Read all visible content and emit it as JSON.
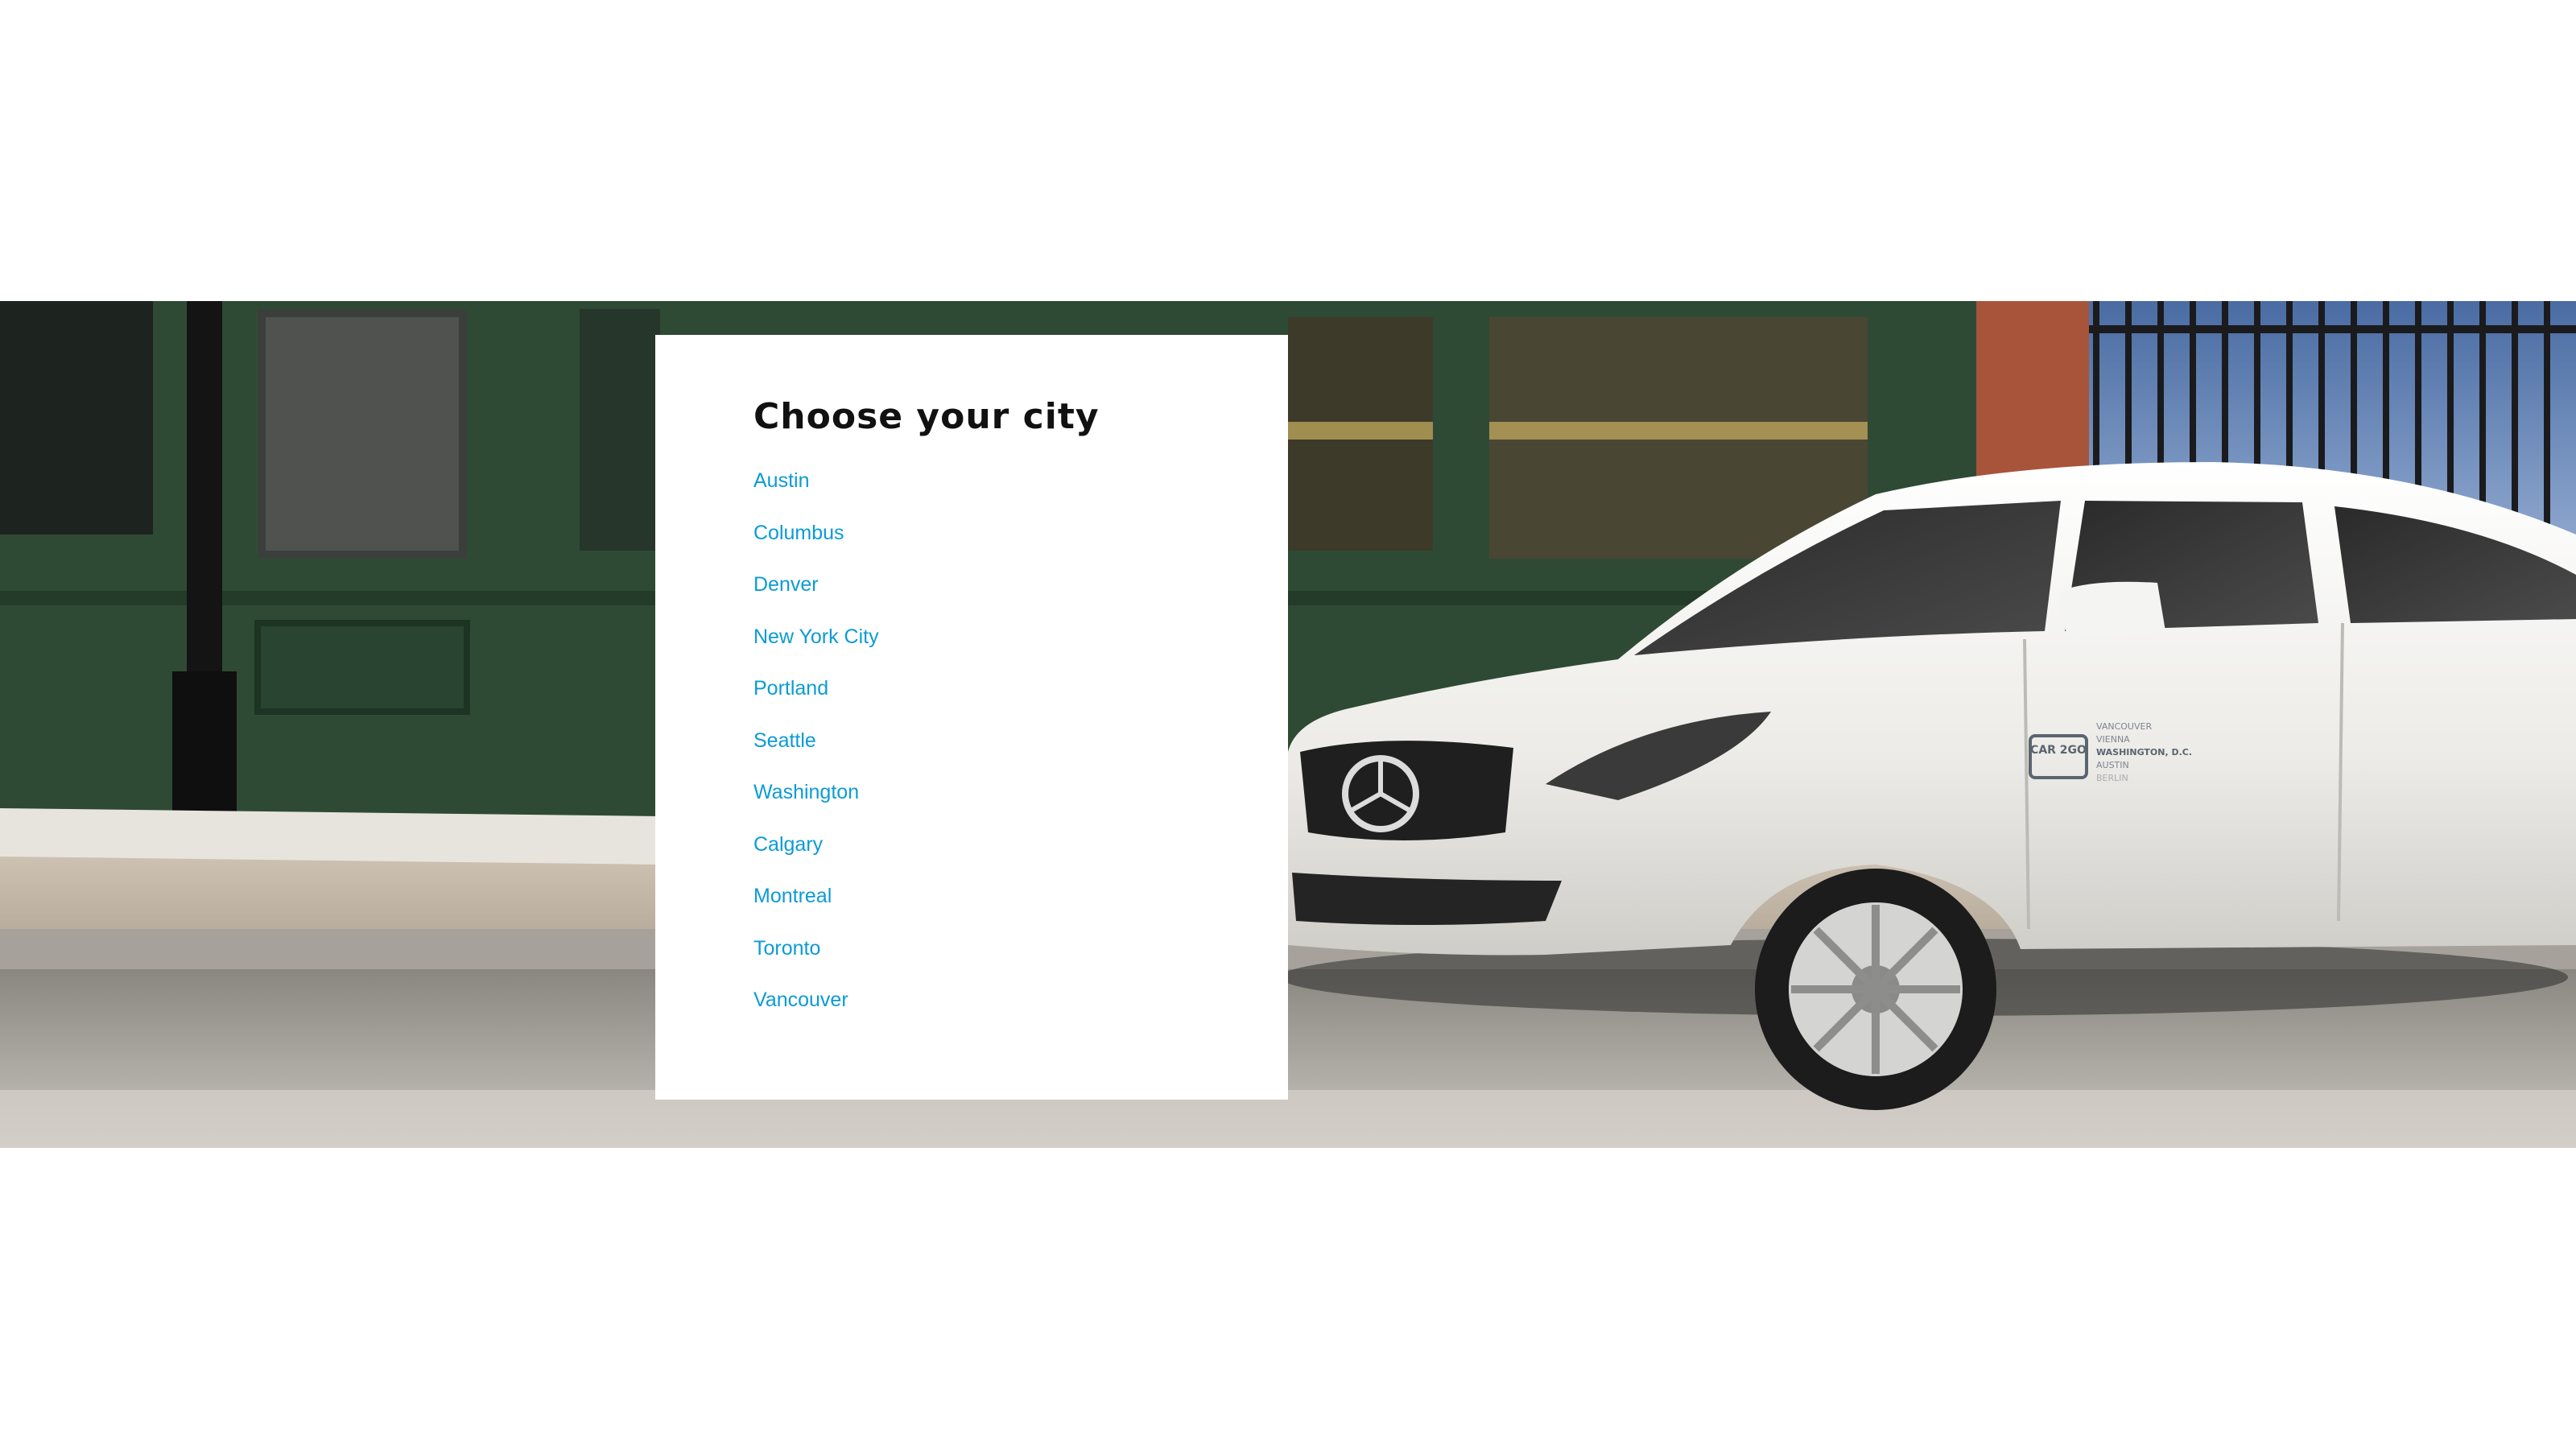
{
  "card": {
    "title": "Choose your city"
  },
  "cities": [
    {
      "label": "Austin"
    },
    {
      "label": "Columbus"
    },
    {
      "label": "Denver"
    },
    {
      "label": "New York City"
    },
    {
      "label": "Portland"
    },
    {
      "label": "Seattle"
    },
    {
      "label": "Washington"
    },
    {
      "label": "Calgary"
    },
    {
      "label": "Montreal"
    },
    {
      "label": "Toronto"
    },
    {
      "label": "Vancouver"
    }
  ],
  "hero": {
    "car_logo": "CAR 2GO",
    "door_cities": [
      "VANCOUVER",
      "VIENNA",
      "WASHINGTON, D.C.",
      "AUSTIN",
      "BERLIN"
    ]
  },
  "colors": {
    "link": "#0b9bd6",
    "heading": "#111111",
    "storefront": "#2f4a34",
    "car": "#f2f2ef"
  }
}
